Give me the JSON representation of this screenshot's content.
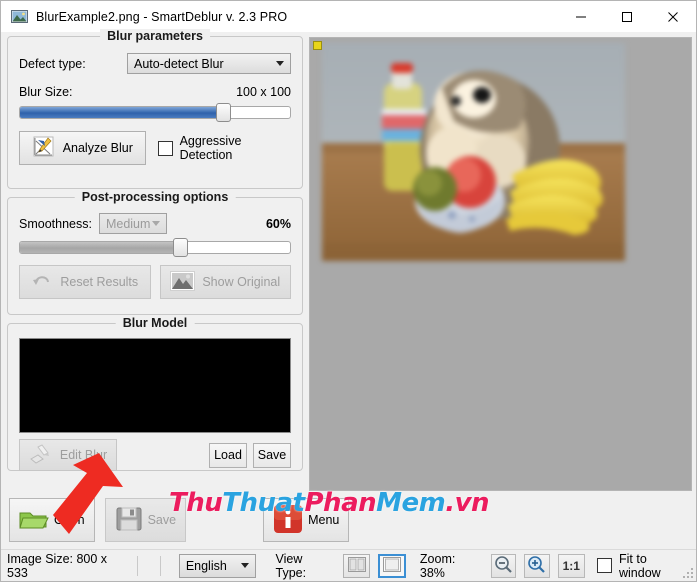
{
  "window": {
    "title": "BlurExample2.png - SmartDeblur v. 2.3 PRO",
    "icon": "image-photo-icon",
    "minimize_label": "—",
    "maximize_label": "▢",
    "close_label": "✕"
  },
  "blur_parameters": {
    "group_title": "Blur parameters",
    "defect_type_label": "Defect type:",
    "defect_type_value": "Auto-detect Blur",
    "defect_type_options": [
      "Auto-detect Blur"
    ],
    "blur_size_label": "Blur Size:",
    "blur_size_value": "100 x 100",
    "blur_size_percent": 75,
    "analyze_button": "Analyze Blur",
    "analyze_icon": "chart-pencil-icon",
    "aggressive_detection_label": "Aggressive Detection",
    "aggressive_detection_checked": false
  },
  "post_processing": {
    "group_title": "Post-processing options",
    "smoothness_label": "Smoothness:",
    "smoothness_value": "Medium",
    "smoothness_options": [
      "Medium"
    ],
    "smoothness_percent_label": "60%",
    "smoothness_percent": 60,
    "reset_button": "Reset Results",
    "reset_icon": "undo-arrow-icon",
    "reset_disabled": true,
    "show_original_button": "Show Original",
    "show_original_icon": "landscape-photo-icon",
    "show_original_disabled": true
  },
  "blur_model": {
    "group_title": "Blur Model",
    "preview_color": "#000000",
    "edit_button": "Edit Blur",
    "edit_icon": "pencil-eraser-icon",
    "edit_disabled": true,
    "load_button": "Load",
    "save_button": "Save"
  },
  "toolbar": {
    "open_button": "Open",
    "open_icon": "open-folder-icon",
    "save_button": "Save",
    "save_icon": "floppy-disk-icon",
    "save_disabled": true,
    "menu_button": "Menu",
    "menu_icon": "info-i-icon"
  },
  "statusbar": {
    "image_size": "Image Size: 800 x 533",
    "language_value": "English",
    "language_options": [
      "English"
    ],
    "view_type_label": "View Type:",
    "view_split_icon": "split-view-icon",
    "view_single_icon": "single-view-icon",
    "view_selected": "single",
    "zoom_label": "Zoom: 38%",
    "zoom_out_icon": "magnifier-minus-icon",
    "zoom_in_icon": "magnifier-plus-icon",
    "zoom_reset_label": "1:1",
    "fit_to_window_label": "Fit to window",
    "fit_to_window_checked": false,
    "resize-grip": "resize-grip-icon"
  },
  "canvas": {
    "background_color": "#a9a9a9",
    "marker": "selection-marker",
    "photo_description": "Blurred photo: hedgehog plush toy with bottle, bowl of fruit and bananas on a table"
  },
  "overlay": {
    "arrow_color": "#ee2b22",
    "arrow_name": "red-annotation-arrow",
    "watermark_parts": [
      {
        "text": "Thu",
        "color": "#ec1c5e"
      },
      {
        "text": "Thuat",
        "color": "#2aa3e0"
      },
      {
        "text": "Phan",
        "color": "#ec1c5e"
      },
      {
        "text": "Mem",
        "color": "#2aa3e0"
      },
      {
        "text": ".vn",
        "color": "#ec1c5e"
      }
    ]
  }
}
